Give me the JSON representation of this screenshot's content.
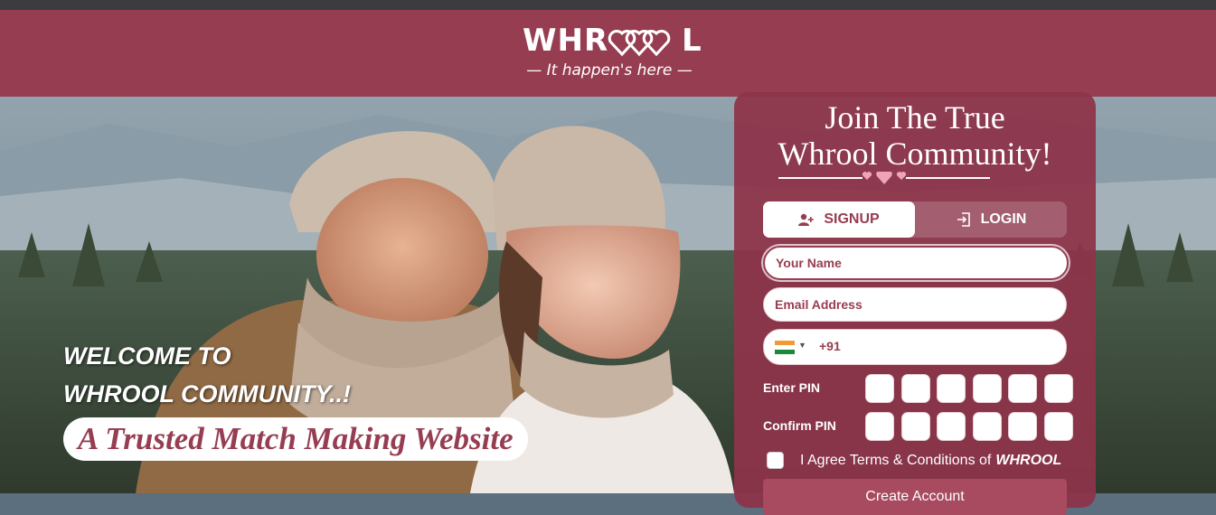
{
  "header": {
    "logo_left": "WHR",
    "logo_right": "L",
    "tagline": "— It happen's here —"
  },
  "hero": {
    "welcome_line1": "WELCOME TO",
    "welcome_line2": "WHROOL COMMUNITY..!",
    "trusted_text": "A Trusted Match Making Website"
  },
  "signup_panel": {
    "title_line1": "Join The True",
    "title_line2": "Whrool Community!",
    "tabs": [
      {
        "label": "SIGNUP",
        "icon": "user-plus-icon",
        "active": true
      },
      {
        "label": "LOGIN",
        "icon": "login-icon",
        "active": false
      }
    ],
    "name_placeholder": "Your Name",
    "email_placeholder": "Email Address",
    "phone": {
      "country_flag": "india-flag-icon",
      "dial_code": "+91"
    },
    "pin_label": "Enter PIN",
    "confirm_pin_label": "Confirm PIN",
    "pin_length": 6,
    "agree_text": "I Agree Terms & Conditions of",
    "agree_brand": "WHROOL",
    "create_button": "Create Account"
  },
  "colors": {
    "brand": "#973d51",
    "panel": "#8d344a",
    "topbar": "#3c3c3e"
  }
}
